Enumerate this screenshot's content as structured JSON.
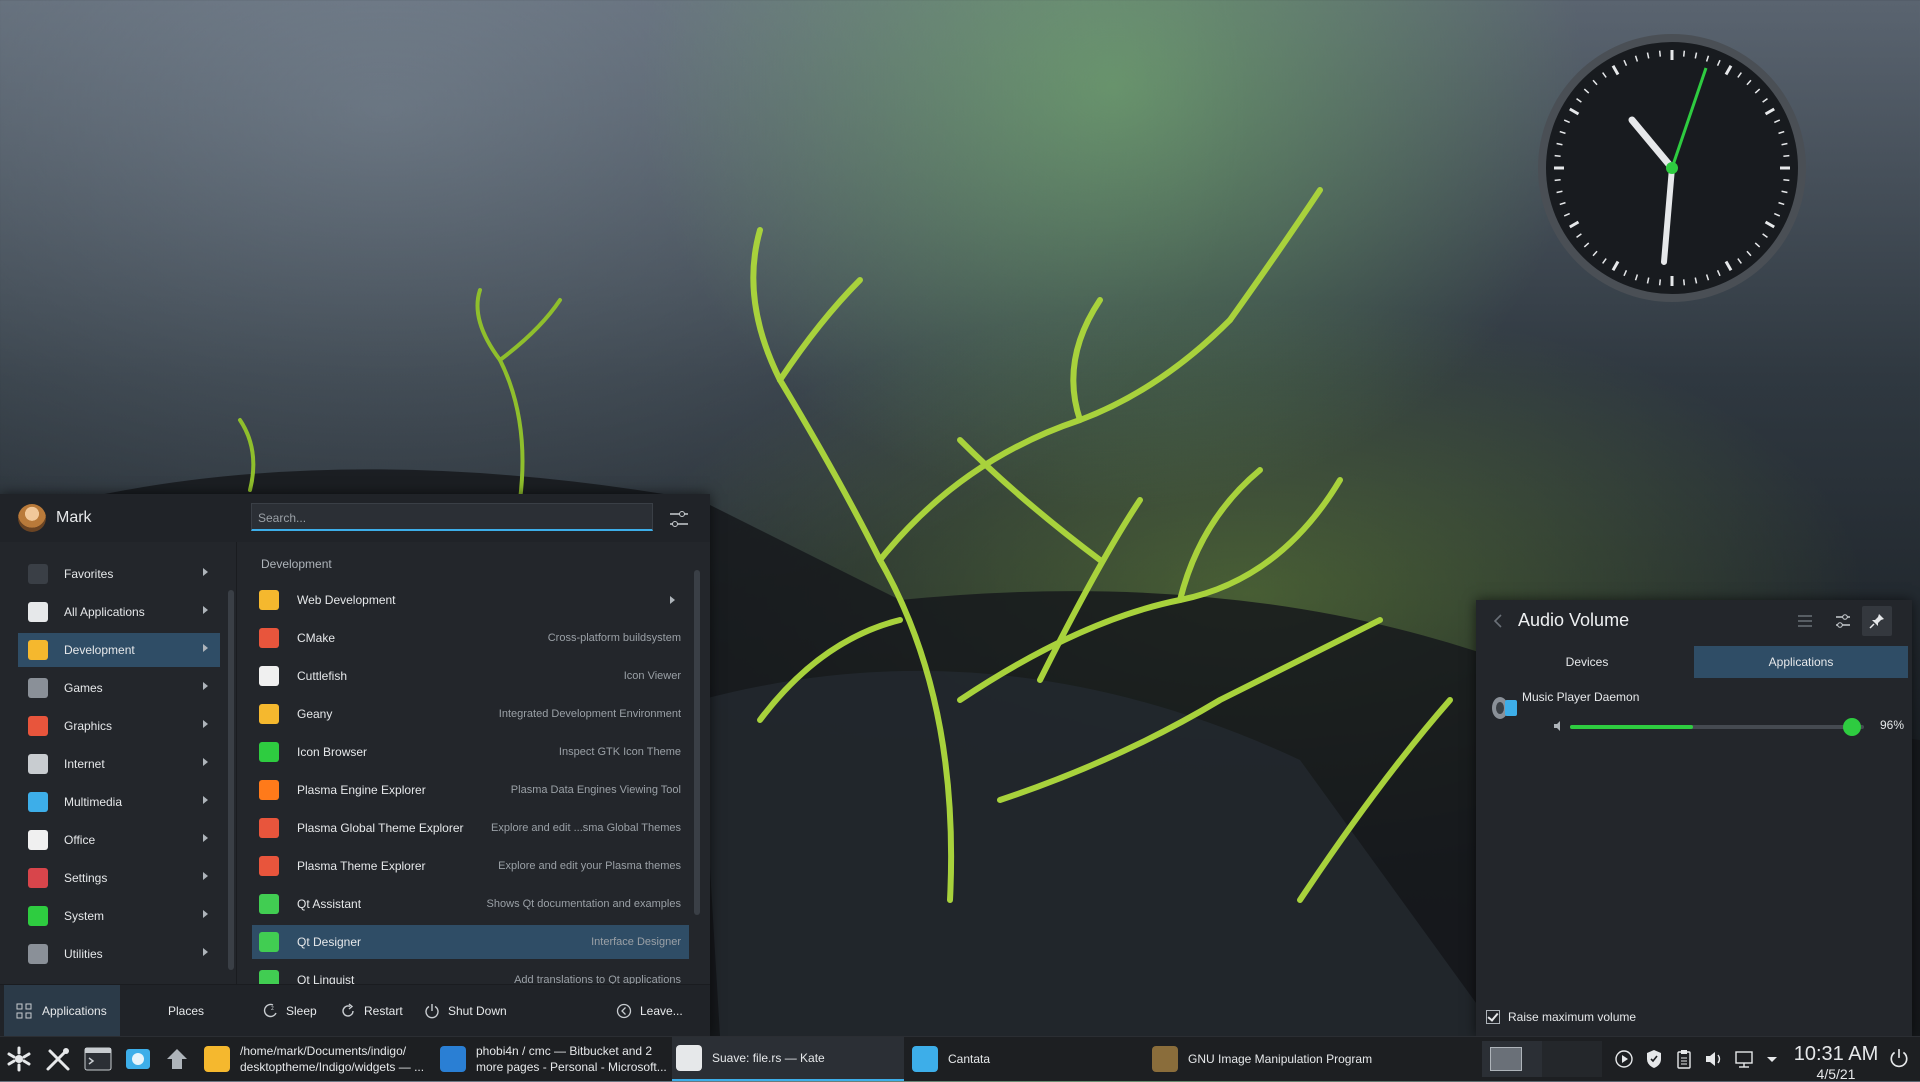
{
  "launcher": {
    "user_name": "Mark",
    "search_placeholder": "Search...",
    "categories": [
      {
        "label": "Favorites",
        "icon": "bookmark-icon"
      },
      {
        "label": "All Applications",
        "icon": "applications-icon"
      },
      {
        "label": "Development",
        "icon": "development-icon"
      },
      {
        "label": "Games",
        "icon": "gamepad-icon"
      },
      {
        "label": "Graphics",
        "icon": "graphics-icon"
      },
      {
        "label": "Internet",
        "icon": "internet-icon"
      },
      {
        "label": "Multimedia",
        "icon": "multimedia-icon"
      },
      {
        "label": "Office",
        "icon": "office-icon"
      },
      {
        "label": "Settings",
        "icon": "settings-icon"
      },
      {
        "label": "System",
        "icon": "system-icon"
      },
      {
        "label": "Utilities",
        "icon": "utilities-icon"
      }
    ],
    "active_category": "Development",
    "section_title": "Development",
    "apps": [
      {
        "name": "Web Development",
        "desc": ""
      },
      {
        "name": "CMake",
        "desc": "Cross-platform buildsystem"
      },
      {
        "name": "Cuttlefish",
        "desc": "Icon Viewer"
      },
      {
        "name": "Geany",
        "desc": "Integrated Development Environment"
      },
      {
        "name": "Icon Browser",
        "desc": "Inspect GTK Icon Theme"
      },
      {
        "name": "Plasma Engine Explorer",
        "desc": "Plasma Data Engines Viewing Tool"
      },
      {
        "name": "Plasma Global Theme Explorer",
        "desc": "Explore and edit ...sma Global Themes"
      },
      {
        "name": "Plasma Theme Explorer",
        "desc": "Explore and edit your Plasma themes"
      },
      {
        "name": "Qt Assistant",
        "desc": "Shows Qt documentation and examples"
      },
      {
        "name": "Qt Designer",
        "desc": "Interface Designer"
      },
      {
        "name": "Qt Linguist",
        "desc": "Add translations to Qt applications"
      }
    ],
    "selected_app": "Qt Designer",
    "footer": {
      "tab_applications": "Applications",
      "tab_places": "Places",
      "sleep": "Sleep",
      "restart": "Restart",
      "shutdown": "Shut Down",
      "leave": "Leave..."
    }
  },
  "audio": {
    "title": "Audio Volume",
    "tab_devices": "Devices",
    "tab_applications": "Applications",
    "stream_name": "Music Player Daemon",
    "volume_percent": 96,
    "volume_label": "96%",
    "meter_level": 0.42,
    "raise_max_label": "Raise maximum volume",
    "raise_max_checked": true
  },
  "taskbar": {
    "tasks": [
      {
        "label": "/home/mark/Documents/indigo/\ndesktoptheme/Indigo/widgets — ...",
        "icon": "folder-icon"
      },
      {
        "label": "phobi4n / cmc — Bitbucket and 2\nmore pages - Personal - Microsoft...",
        "icon": "edge-dev-icon"
      },
      {
        "label": "Suave: file.rs  — Kate",
        "icon": "kate-icon"
      },
      {
        "label": "Cantata",
        "icon": "cantata-icon"
      },
      {
        "label": "GNU Image Manipulation Program",
        "icon": "gimp-icon"
      }
    ],
    "time": "10:31 AM",
    "date": "4/5/21"
  },
  "colors": {
    "accent": "#3daee9",
    "selection": "#2f4d66",
    "panel": "#23262b",
    "volume_green": "#2ecc40"
  }
}
